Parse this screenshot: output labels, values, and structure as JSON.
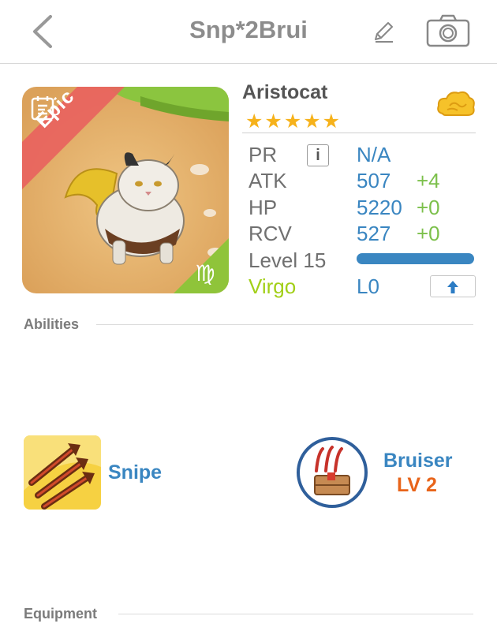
{
  "header": {
    "title": "Snp*2Brui"
  },
  "card": {
    "name": "Aristocat",
    "stars": "★★★★★",
    "rarity": "Epic",
    "sign": "Virgo"
  },
  "stats": {
    "pr": {
      "label": "PR",
      "value": "N/A",
      "info": "i"
    },
    "atk": {
      "label": "ATK",
      "value": "507",
      "bonus": "+4"
    },
    "hp": {
      "label": "HP",
      "value": "5220",
      "bonus": "+0"
    },
    "rcv": {
      "label": "RCV",
      "value": "527",
      "bonus": "+0"
    },
    "level": {
      "label": "Level 15",
      "progress": 1.0
    },
    "sign_level": "L0"
  },
  "sections": {
    "abilities": "Abilities",
    "equipment": "Equipment"
  },
  "abilities": [
    {
      "name": "Snipe",
      "icon": "triple-arrow-icon"
    },
    {
      "name": "Bruiser",
      "level": "LV 2",
      "icon": "claw-crate-icon"
    }
  ],
  "colors": {
    "value_blue": "#3a86c1",
    "bonus_green": "#7cc04b",
    "virgo_green": "#a2cf18",
    "level_orange": "#e8641a",
    "star_gold": "#f6b21b",
    "epic_red": "#e8635e"
  }
}
